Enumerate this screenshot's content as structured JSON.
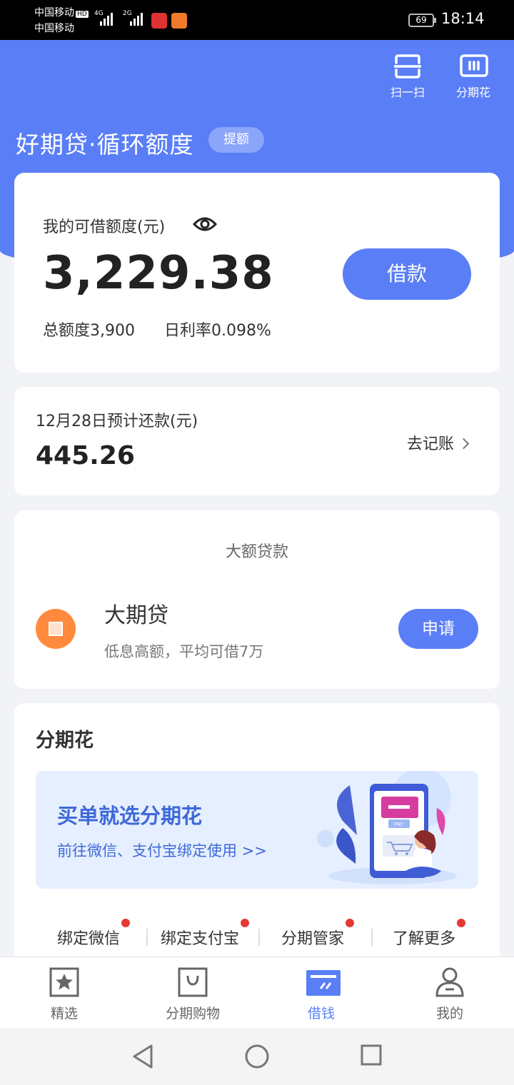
{
  "status_bar": {
    "carrier1": "中国移动",
    "carrier2": "中国移动",
    "hd": "HD",
    "net1": "4G",
    "net2": "2G",
    "battery": "69",
    "time": "18:14"
  },
  "header": {
    "scan_label": "扫一扫",
    "installment_label": "分期花",
    "brand_title": "好期贷·循环额度",
    "raise_label": "提额"
  },
  "credit_card": {
    "available_label": "我的可借额度(元)",
    "available_amount": "3,229.38",
    "total_label": "总额度3,900",
    "rate_label": "日利率0.098%",
    "borrow_button": "借款"
  },
  "repay_card": {
    "due_label": "12月28日预计还款(元)",
    "due_amount": "445.26",
    "record_link": "去记账"
  },
  "large_loan": {
    "section_title": "大额贷款",
    "product_name": "大期贷",
    "product_desc": "低息高额，平均可借7万",
    "apply_button": "申请"
  },
  "fenqihua": {
    "section_title": "分期花",
    "banner_headline": "买单就选分期花",
    "banner_sub": "前往微信、支付宝绑定使用 >>",
    "banner_pay_text": "PAY",
    "links": [
      "绑定微信",
      "绑定支付宝",
      "分期管家",
      "了解更多"
    ]
  },
  "tabbar": {
    "tabs": [
      "精选",
      "分期购物",
      "借钱",
      "我的"
    ],
    "active_index": 2
  },
  "colors": {
    "primary": "#5a7ef6",
    "accent_orange": "#ff8a3d",
    "badge_red": "#e53935"
  }
}
